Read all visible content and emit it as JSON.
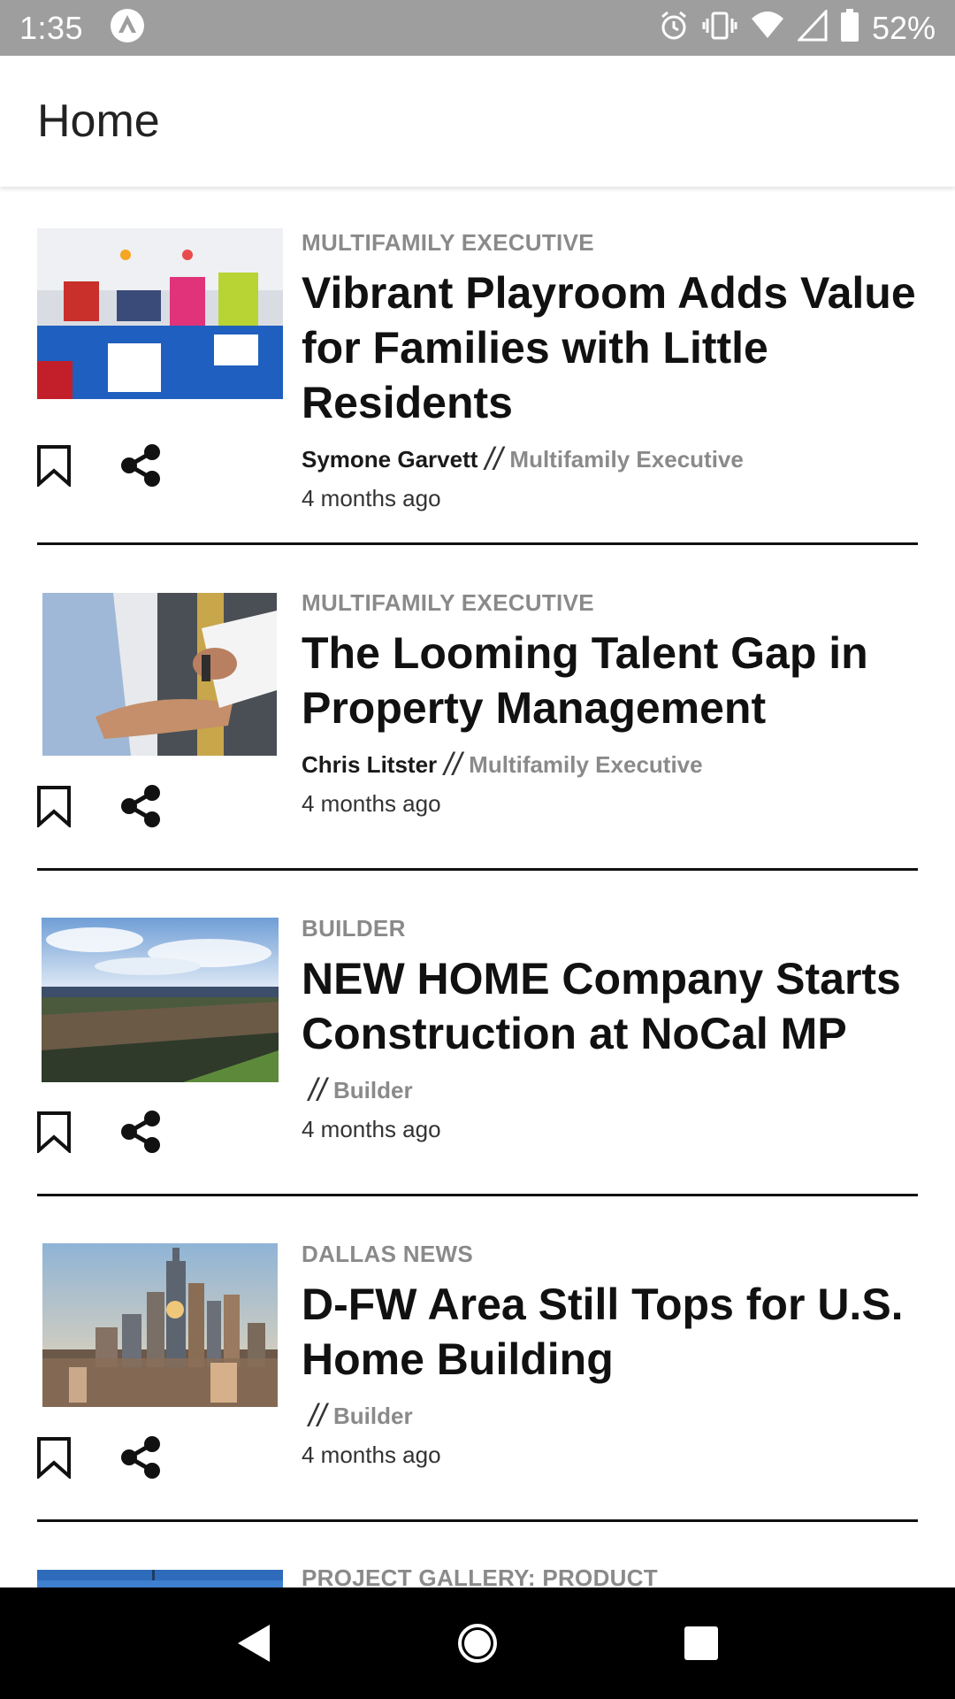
{
  "status_bar": {
    "time": "1:35",
    "battery": "52%",
    "icons": [
      "app-badge-icon",
      "alarm-icon",
      "vibrate-icon",
      "wifi-icon",
      "signal-icon",
      "battery-icon"
    ]
  },
  "app_bar": {
    "title": "Home"
  },
  "articles": [
    {
      "source": "MULTIFAMILY EXECUTIVE",
      "headline": "Vibrant Playroom Adds Value for Families with Little Residents",
      "author": "Symone Garvett",
      "separator": "//",
      "publisher": "Multifamily Executive",
      "date": "4 months ago"
    },
    {
      "source": "MULTIFAMILY EXECUTIVE",
      "headline": "The Looming Talent Gap in Property Management",
      "author": "Chris Litster",
      "separator": "//",
      "publisher": "Multifamily Executive",
      "date": "4 months ago"
    },
    {
      "source": "BUILDER",
      "headline": "NEW HOME Company Starts Construction at NoCal MP",
      "author": "",
      "separator": "//",
      "publisher": "Builder",
      "date": "4 months ago"
    },
    {
      "source": "DALLAS NEWS",
      "headline": "D-FW Area Still Tops for U.S. Home Building",
      "author": "",
      "separator": "//",
      "publisher": "Builder",
      "date": "4 months ago"
    },
    {
      "source": "PROJECT GALLERY: PRODUCT"
    }
  ],
  "colors": {
    "status_bar": "#9e9e9e",
    "source_tag": "#8a8a8a",
    "headline": "#111111",
    "nav_bar": "#000000"
  }
}
